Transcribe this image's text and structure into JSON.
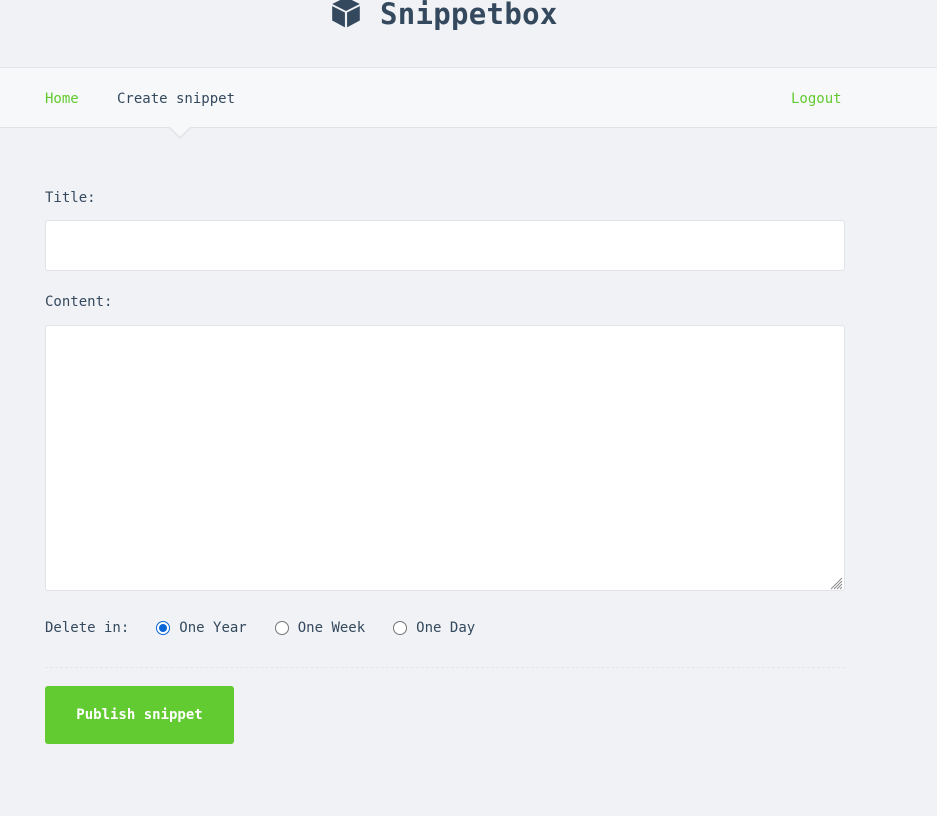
{
  "brand": {
    "name": "Snippetbox",
    "icon": "cube-icon"
  },
  "nav": {
    "home": "Home",
    "create": "Create snippet",
    "logout": "Logout"
  },
  "form": {
    "title_label": "Title:",
    "title_value": "",
    "content_label": "Content:",
    "content_value": "",
    "delete_label": "Delete in:",
    "expires_options": [
      {
        "label": "One Year",
        "selected": true
      },
      {
        "label": "One Week",
        "selected": false
      },
      {
        "label": "One Day",
        "selected": false
      }
    ],
    "submit_label": "Publish snippet"
  },
  "colors": {
    "accent": "#62cb31",
    "text": "#34495e",
    "background": "#f1f2f5",
    "radio_selected": "#0a66d6"
  }
}
